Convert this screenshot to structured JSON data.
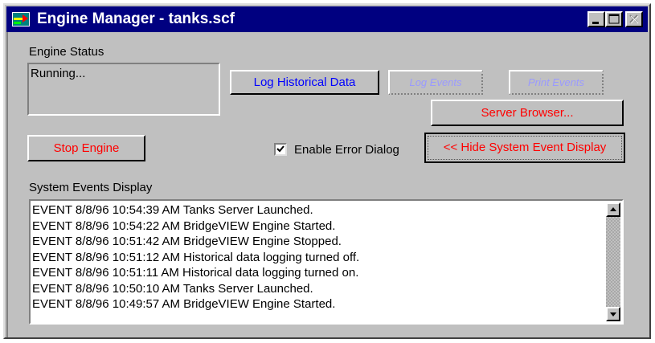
{
  "window": {
    "title": "Engine Manager - tanks.scf",
    "colors": {
      "titlebar": "#000080",
      "face": "#c0c0c0",
      "accent_blue": "#0000ff",
      "accent_red": "#ff0000"
    },
    "title_icon": "app-icon",
    "controls": [
      {
        "name": "minimize",
        "icon": "minimize-icon"
      },
      {
        "name": "maximize",
        "icon": "maximize-icon"
      },
      {
        "name": "close",
        "icon": "close-icon",
        "enabled": false
      }
    ]
  },
  "engine_status": {
    "label": "Engine Status",
    "value": "Running..."
  },
  "buttons": {
    "log_historical": "Log Historical Data",
    "log_events": "Log Events",
    "print_events": "Print Events",
    "server_browser": "Server Browser...",
    "stop_engine": "Stop Engine",
    "hide_display": "<< Hide System Event Display"
  },
  "checkbox": {
    "label": "Enable Error Dialog",
    "checked": true
  },
  "events": {
    "label": "System Events Display",
    "rows": [
      "EVENT 8/8/96 10:54:39 AM Tanks Server Launched.",
      "EVENT 8/8/96 10:54:22 AM BridgeVIEW Engine Started.",
      "EVENT 8/8/96 10:51:42 AM BridgeVIEW Engine Stopped.",
      "EVENT 8/8/96 10:51:12 AM Historical data logging turned off.",
      "EVENT 8/8/96 10:51:11 AM Historical data logging turned on.",
      "EVENT 8/8/96 10:50:10 AM Tanks Server Launched.",
      "EVENT 8/8/96 10:49:57 AM BridgeVIEW Engine Started."
    ]
  }
}
